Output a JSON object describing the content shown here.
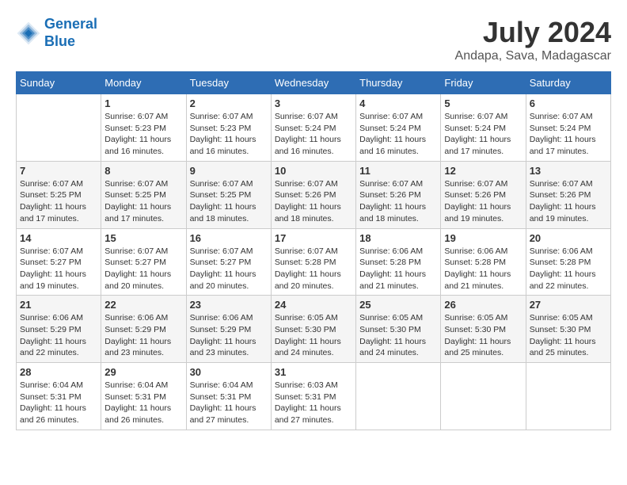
{
  "logo": {
    "text_general": "General",
    "text_blue": "Blue"
  },
  "title": "July 2024",
  "location": "Andapa, Sava, Madagascar",
  "days_of_week": [
    "Sunday",
    "Monday",
    "Tuesday",
    "Wednesday",
    "Thursday",
    "Friday",
    "Saturday"
  ],
  "weeks": [
    [
      {
        "day": "",
        "info": ""
      },
      {
        "day": "1",
        "info": "Sunrise: 6:07 AM\nSunset: 5:23 PM\nDaylight: 11 hours\nand 16 minutes."
      },
      {
        "day": "2",
        "info": "Sunrise: 6:07 AM\nSunset: 5:23 PM\nDaylight: 11 hours\nand 16 minutes."
      },
      {
        "day": "3",
        "info": "Sunrise: 6:07 AM\nSunset: 5:24 PM\nDaylight: 11 hours\nand 16 minutes."
      },
      {
        "day": "4",
        "info": "Sunrise: 6:07 AM\nSunset: 5:24 PM\nDaylight: 11 hours\nand 16 minutes."
      },
      {
        "day": "5",
        "info": "Sunrise: 6:07 AM\nSunset: 5:24 PM\nDaylight: 11 hours\nand 17 minutes."
      },
      {
        "day": "6",
        "info": "Sunrise: 6:07 AM\nSunset: 5:24 PM\nDaylight: 11 hours\nand 17 minutes."
      }
    ],
    [
      {
        "day": "7",
        "info": "Sunrise: 6:07 AM\nSunset: 5:25 PM\nDaylight: 11 hours\nand 17 minutes."
      },
      {
        "day": "8",
        "info": "Sunrise: 6:07 AM\nSunset: 5:25 PM\nDaylight: 11 hours\nand 17 minutes."
      },
      {
        "day": "9",
        "info": "Sunrise: 6:07 AM\nSunset: 5:25 PM\nDaylight: 11 hours\nand 18 minutes."
      },
      {
        "day": "10",
        "info": "Sunrise: 6:07 AM\nSunset: 5:26 PM\nDaylight: 11 hours\nand 18 minutes."
      },
      {
        "day": "11",
        "info": "Sunrise: 6:07 AM\nSunset: 5:26 PM\nDaylight: 11 hours\nand 18 minutes."
      },
      {
        "day": "12",
        "info": "Sunrise: 6:07 AM\nSunset: 5:26 PM\nDaylight: 11 hours\nand 19 minutes."
      },
      {
        "day": "13",
        "info": "Sunrise: 6:07 AM\nSunset: 5:26 PM\nDaylight: 11 hours\nand 19 minutes."
      }
    ],
    [
      {
        "day": "14",
        "info": "Sunrise: 6:07 AM\nSunset: 5:27 PM\nDaylight: 11 hours\nand 19 minutes."
      },
      {
        "day": "15",
        "info": "Sunrise: 6:07 AM\nSunset: 5:27 PM\nDaylight: 11 hours\nand 20 minutes."
      },
      {
        "day": "16",
        "info": "Sunrise: 6:07 AM\nSunset: 5:27 PM\nDaylight: 11 hours\nand 20 minutes."
      },
      {
        "day": "17",
        "info": "Sunrise: 6:07 AM\nSunset: 5:28 PM\nDaylight: 11 hours\nand 20 minutes."
      },
      {
        "day": "18",
        "info": "Sunrise: 6:06 AM\nSunset: 5:28 PM\nDaylight: 11 hours\nand 21 minutes."
      },
      {
        "day": "19",
        "info": "Sunrise: 6:06 AM\nSunset: 5:28 PM\nDaylight: 11 hours\nand 21 minutes."
      },
      {
        "day": "20",
        "info": "Sunrise: 6:06 AM\nSunset: 5:28 PM\nDaylight: 11 hours\nand 22 minutes."
      }
    ],
    [
      {
        "day": "21",
        "info": "Sunrise: 6:06 AM\nSunset: 5:29 PM\nDaylight: 11 hours\nand 22 minutes."
      },
      {
        "day": "22",
        "info": "Sunrise: 6:06 AM\nSunset: 5:29 PM\nDaylight: 11 hours\nand 23 minutes."
      },
      {
        "day": "23",
        "info": "Sunrise: 6:06 AM\nSunset: 5:29 PM\nDaylight: 11 hours\nand 23 minutes."
      },
      {
        "day": "24",
        "info": "Sunrise: 6:05 AM\nSunset: 5:30 PM\nDaylight: 11 hours\nand 24 minutes."
      },
      {
        "day": "25",
        "info": "Sunrise: 6:05 AM\nSunset: 5:30 PM\nDaylight: 11 hours\nand 24 minutes."
      },
      {
        "day": "26",
        "info": "Sunrise: 6:05 AM\nSunset: 5:30 PM\nDaylight: 11 hours\nand 25 minutes."
      },
      {
        "day": "27",
        "info": "Sunrise: 6:05 AM\nSunset: 5:30 PM\nDaylight: 11 hours\nand 25 minutes."
      }
    ],
    [
      {
        "day": "28",
        "info": "Sunrise: 6:04 AM\nSunset: 5:31 PM\nDaylight: 11 hours\nand 26 minutes."
      },
      {
        "day": "29",
        "info": "Sunrise: 6:04 AM\nSunset: 5:31 PM\nDaylight: 11 hours\nand 26 minutes."
      },
      {
        "day": "30",
        "info": "Sunrise: 6:04 AM\nSunset: 5:31 PM\nDaylight: 11 hours\nand 27 minutes."
      },
      {
        "day": "31",
        "info": "Sunrise: 6:03 AM\nSunset: 5:31 PM\nDaylight: 11 hours\nand 27 minutes."
      },
      {
        "day": "",
        "info": ""
      },
      {
        "day": "",
        "info": ""
      },
      {
        "day": "",
        "info": ""
      }
    ]
  ]
}
